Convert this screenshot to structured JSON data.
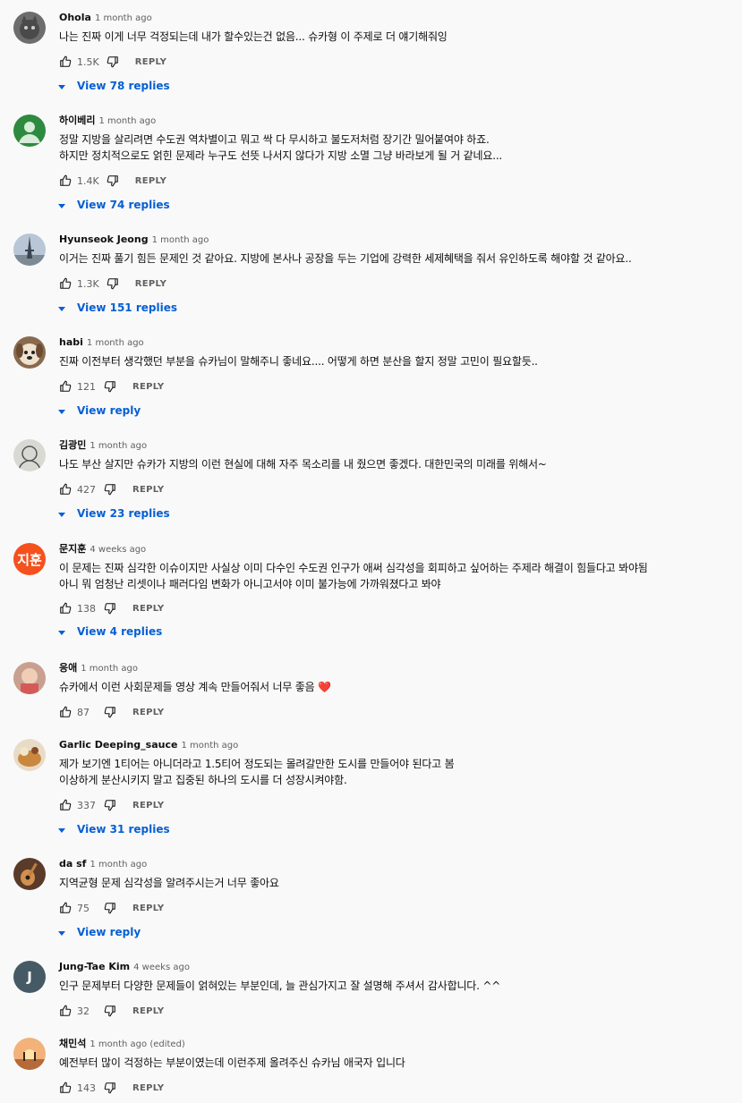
{
  "colors": {
    "link": "#065fd4",
    "meta": "#606060",
    "heart": "#e53935"
  },
  "comments": [
    {
      "author": "Ohola",
      "time": "1 month ago",
      "text": "나는 진짜 이게 너무 걱정되는데 내가 할수있는건 없음... 슈카형 이 주제로 더 얘기해줘잉",
      "likes": "1.5K",
      "reply_label": "REPLY",
      "view_replies": "View 78 replies",
      "avatar": "cat-avatar"
    },
    {
      "author": "하이베리",
      "time": "1 month ago",
      "text": "정말 지방을 살리려면 수도권 역차별이고 뭐고 싹 다 무시하고 불도저처럼 장기간 밀어붙여야 하죠.\n하지만 정치적으로도 얽힌 문제라 누구도 선뜻 나서지 않다가 지방 소멸 그냥 바라보게 될 거 같네요...",
      "likes": "1.4K",
      "reply_label": "REPLY",
      "view_replies": "View 74 replies",
      "avatar": "default-user-avatar"
    },
    {
      "author": "Hyunseok Jeong",
      "time": "1 month ago",
      "text": "이거는 진짜 풀기 힘든 문제인 것 같아요. 지방에 본사나 공장을 두는 기업에 강력한 세제혜택을 줘서 유인하도록 해야할 것 같아요..",
      "likes": "1.3K",
      "reply_label": "REPLY",
      "view_replies": "View 151 replies",
      "avatar": "eiffel-avatar"
    },
    {
      "author": "habi",
      "time": "1 month ago",
      "text": "진짜 이전부터 생각했던 부분을 슈카님이 말해주니 좋네요.... 어떻게 하면 분산을 할지 정말 고민이 필요할듯..",
      "likes": "121",
      "reply_label": "REPLY",
      "view_replies": "View reply",
      "avatar": "dog-avatar"
    },
    {
      "author": "김광민",
      "time": "1 month ago",
      "text": "나도 부산 살지만 슈카가 지방의 이런 현실에 대해 자주 목소리를 내 줬으면 좋겠다. 대한민국의 미래를 위해서~",
      "likes": "427",
      "reply_label": "REPLY",
      "view_replies": "View 23 replies",
      "avatar": "sketch-avatar"
    },
    {
      "author": "문지훈",
      "time": "4 weeks ago",
      "text": "이 문제는 진짜 심각한 이슈이지만 사실상 이미 다수인 수도권 인구가 애써 심각성을 회피하고 싶어하는 주제라 해결이 힘들다고 봐야됨\n아니 뭐 엄청난 리셋이나 패러다임 변화가 아니고서야 이미 불가능에 가까워졌다고 봐야",
      "likes": "138",
      "reply_label": "REPLY",
      "view_replies": "View 4 replies",
      "avatar_letter": "지훈",
      "avatar": "letter-avatar"
    },
    {
      "author": "응애",
      "time": "1 month ago",
      "text": "슈카에서 이런 사회문제들 영상 계속 만들어줘서 너무 좋음",
      "emoji": "❤️",
      "likes": "87",
      "reply_label": "REPLY",
      "avatar": "photo-avatar"
    },
    {
      "author": "Garlic Deeping_sauce",
      "time": "1 month ago",
      "text": "제가 보기엔 1티어는 아니더라고 1.5티어 정도되는 몰려갈만한 도시를 만들어야 된다고 봄\n이상하게 분산시키지 말고 집중된 하나의 도시를 더 성장시켜야함.",
      "likes": "337",
      "reply_label": "REPLY",
      "view_replies": "View 31 replies",
      "avatar": "food-avatar"
    },
    {
      "author": "da sf",
      "time": "1 month ago",
      "text": "지역균형 문제 심각성을 알려주시는거 너무 좋아요",
      "likes": "75",
      "reply_label": "REPLY",
      "view_replies": "View reply",
      "avatar": "guitar-avatar"
    },
    {
      "author": "Jung-Tae Kim",
      "time": "4 weeks ago",
      "text": "인구 문제부터 다양한 문제들이 얽혀있는 부분인데, 늘 관심가지고 잘 설명해 주셔서 감사합니다. ^^",
      "likes": "32",
      "reply_label": "REPLY",
      "avatar_letter": "J",
      "avatar": "letter-avatar"
    },
    {
      "author": "채민석",
      "time": "1 month ago (edited)",
      "text": "예전부터 많이 걱정하는 부분이였는데 이런주제 올려주신 슈카님 애국자 입니다",
      "likes": "143",
      "reply_label": "REPLY",
      "avatar": "sunset-avatar"
    }
  ]
}
